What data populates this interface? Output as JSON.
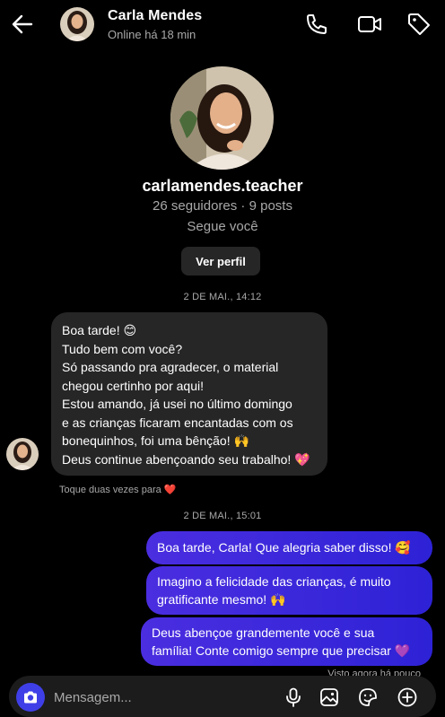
{
  "header": {
    "name": "Carla Mendes",
    "status": "Online há 18 min",
    "icons": [
      "back-arrow-icon",
      "phone-icon",
      "video-camera-icon",
      "tag-icon"
    ]
  },
  "profile": {
    "handle": "carlamendes.teacher",
    "stats": "26 seguidores · 9 posts",
    "follows_you": "Segue você",
    "view_profile_label": "Ver perfil"
  },
  "timestamps": {
    "first": "2 DE MAI., 14:12",
    "second": "2 DE MAI., 15:01"
  },
  "received_message": {
    "lines": [
      "Boa tarde! 😊",
      "Tudo bem com você?",
      "Só passando pra agradecer, o material",
      "chegou certinho por aqui!",
      "Estou amando, já usei no último domingo",
      "e as crianças ficaram encantadas com os",
      "bonequinhos, foi uma bênção! 🙌",
      "Deus continue abençoando seu trabalho! 💖"
    ],
    "hint": "Toque duas vezes para ❤️"
  },
  "sent_messages": [
    {
      "lines": [
        "Boa tarde, Carla! Que alegria saber disso! 🥰"
      ]
    },
    {
      "lines": [
        "Imagino a felicidade das crianças, é muito",
        "gratificante mesmo! 🙌"
      ]
    },
    {
      "lines": [
        "Deus abençoe grandemente você e sua",
        "família! Conte comigo sempre que precisar 💜"
      ]
    }
  ],
  "seen_status": "Visto agora há pouco",
  "composer": {
    "placeholder": "Mensagem...",
    "icons": [
      "camera-icon",
      "microphone-icon",
      "image-icon",
      "sticker-icon",
      "plus-circle-icon"
    ]
  },
  "colors": {
    "background": "#000000",
    "received_bubble": "#262626",
    "sent_bubble_start": "#4a2ee0",
    "sent_bubble_end": "#2e22d6",
    "secondary_text": "#a8a8a8",
    "camera_button": "#3f3fe8"
  }
}
